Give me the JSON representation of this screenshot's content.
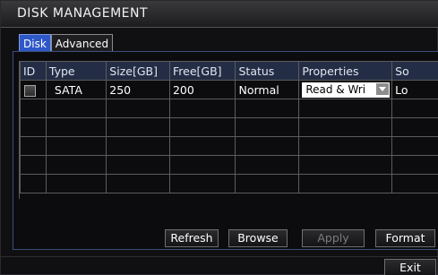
{
  "window": {
    "title": "DISK MANAGEMENT"
  },
  "tabs": [
    {
      "label": "Disk",
      "active": true
    },
    {
      "label": "Advanced",
      "active": false
    }
  ],
  "table": {
    "columns": [
      "ID",
      "Type",
      "Size[GB]",
      "Free[GB]",
      "Status",
      "Properties",
      "So"
    ],
    "rows": [
      {
        "type": "SATA",
        "size": "250",
        "free": "200",
        "status": "Normal",
        "properties": "Read & Wri",
        "source": "Lo"
      }
    ],
    "empty_rows": 5
  },
  "buttons": {
    "refresh": "Refresh",
    "browse": "Browse",
    "apply": "Apply",
    "format": "Format",
    "exit": "Exit"
  },
  "colors": {
    "tab_active": "#2e57c8",
    "header_bg": "#232d45",
    "panel_border": "#3d4f7a"
  }
}
